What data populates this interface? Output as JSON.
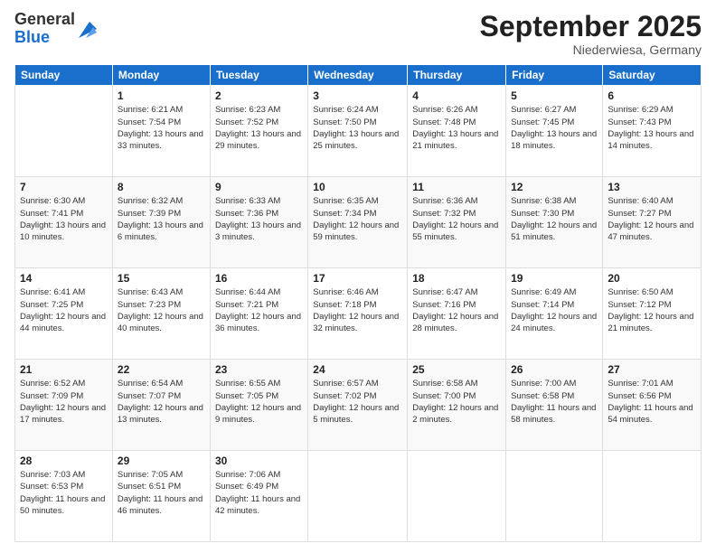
{
  "logo": {
    "general": "General",
    "blue": "Blue"
  },
  "header": {
    "month": "September 2025",
    "location": "Niederwiesa, Germany"
  },
  "weekdays": [
    "Sunday",
    "Monday",
    "Tuesday",
    "Wednesday",
    "Thursday",
    "Friday",
    "Saturday"
  ],
  "weeks": [
    [
      {
        "day": "",
        "info": ""
      },
      {
        "day": "1",
        "info": "Sunrise: 6:21 AM\nSunset: 7:54 PM\nDaylight: 13 hours\nand 33 minutes."
      },
      {
        "day": "2",
        "info": "Sunrise: 6:23 AM\nSunset: 7:52 PM\nDaylight: 13 hours\nand 29 minutes."
      },
      {
        "day": "3",
        "info": "Sunrise: 6:24 AM\nSunset: 7:50 PM\nDaylight: 13 hours\nand 25 minutes."
      },
      {
        "day": "4",
        "info": "Sunrise: 6:26 AM\nSunset: 7:48 PM\nDaylight: 13 hours\nand 21 minutes."
      },
      {
        "day": "5",
        "info": "Sunrise: 6:27 AM\nSunset: 7:45 PM\nDaylight: 13 hours\nand 18 minutes."
      },
      {
        "day": "6",
        "info": "Sunrise: 6:29 AM\nSunset: 7:43 PM\nDaylight: 13 hours\nand 14 minutes."
      }
    ],
    [
      {
        "day": "7",
        "info": "Sunrise: 6:30 AM\nSunset: 7:41 PM\nDaylight: 13 hours\nand 10 minutes."
      },
      {
        "day": "8",
        "info": "Sunrise: 6:32 AM\nSunset: 7:39 PM\nDaylight: 13 hours\nand 6 minutes."
      },
      {
        "day": "9",
        "info": "Sunrise: 6:33 AM\nSunset: 7:36 PM\nDaylight: 13 hours\nand 3 minutes."
      },
      {
        "day": "10",
        "info": "Sunrise: 6:35 AM\nSunset: 7:34 PM\nDaylight: 12 hours\nand 59 minutes."
      },
      {
        "day": "11",
        "info": "Sunrise: 6:36 AM\nSunset: 7:32 PM\nDaylight: 12 hours\nand 55 minutes."
      },
      {
        "day": "12",
        "info": "Sunrise: 6:38 AM\nSunset: 7:30 PM\nDaylight: 12 hours\nand 51 minutes."
      },
      {
        "day": "13",
        "info": "Sunrise: 6:40 AM\nSunset: 7:27 PM\nDaylight: 12 hours\nand 47 minutes."
      }
    ],
    [
      {
        "day": "14",
        "info": "Sunrise: 6:41 AM\nSunset: 7:25 PM\nDaylight: 12 hours\nand 44 minutes."
      },
      {
        "day": "15",
        "info": "Sunrise: 6:43 AM\nSunset: 7:23 PM\nDaylight: 12 hours\nand 40 minutes."
      },
      {
        "day": "16",
        "info": "Sunrise: 6:44 AM\nSunset: 7:21 PM\nDaylight: 12 hours\nand 36 minutes."
      },
      {
        "day": "17",
        "info": "Sunrise: 6:46 AM\nSunset: 7:18 PM\nDaylight: 12 hours\nand 32 minutes."
      },
      {
        "day": "18",
        "info": "Sunrise: 6:47 AM\nSunset: 7:16 PM\nDaylight: 12 hours\nand 28 minutes."
      },
      {
        "day": "19",
        "info": "Sunrise: 6:49 AM\nSunset: 7:14 PM\nDaylight: 12 hours\nand 24 minutes."
      },
      {
        "day": "20",
        "info": "Sunrise: 6:50 AM\nSunset: 7:12 PM\nDaylight: 12 hours\nand 21 minutes."
      }
    ],
    [
      {
        "day": "21",
        "info": "Sunrise: 6:52 AM\nSunset: 7:09 PM\nDaylight: 12 hours\nand 17 minutes."
      },
      {
        "day": "22",
        "info": "Sunrise: 6:54 AM\nSunset: 7:07 PM\nDaylight: 12 hours\nand 13 minutes."
      },
      {
        "day": "23",
        "info": "Sunrise: 6:55 AM\nSunset: 7:05 PM\nDaylight: 12 hours\nand 9 minutes."
      },
      {
        "day": "24",
        "info": "Sunrise: 6:57 AM\nSunset: 7:02 PM\nDaylight: 12 hours\nand 5 minutes."
      },
      {
        "day": "25",
        "info": "Sunrise: 6:58 AM\nSunset: 7:00 PM\nDaylight: 12 hours\nand 2 minutes."
      },
      {
        "day": "26",
        "info": "Sunrise: 7:00 AM\nSunset: 6:58 PM\nDaylight: 11 hours\nand 58 minutes."
      },
      {
        "day": "27",
        "info": "Sunrise: 7:01 AM\nSunset: 6:56 PM\nDaylight: 11 hours\nand 54 minutes."
      }
    ],
    [
      {
        "day": "28",
        "info": "Sunrise: 7:03 AM\nSunset: 6:53 PM\nDaylight: 11 hours\nand 50 minutes."
      },
      {
        "day": "29",
        "info": "Sunrise: 7:05 AM\nSunset: 6:51 PM\nDaylight: 11 hours\nand 46 minutes."
      },
      {
        "day": "30",
        "info": "Sunrise: 7:06 AM\nSunset: 6:49 PM\nDaylight: 11 hours\nand 42 minutes."
      },
      {
        "day": "",
        "info": ""
      },
      {
        "day": "",
        "info": ""
      },
      {
        "day": "",
        "info": ""
      },
      {
        "day": "",
        "info": ""
      }
    ]
  ]
}
